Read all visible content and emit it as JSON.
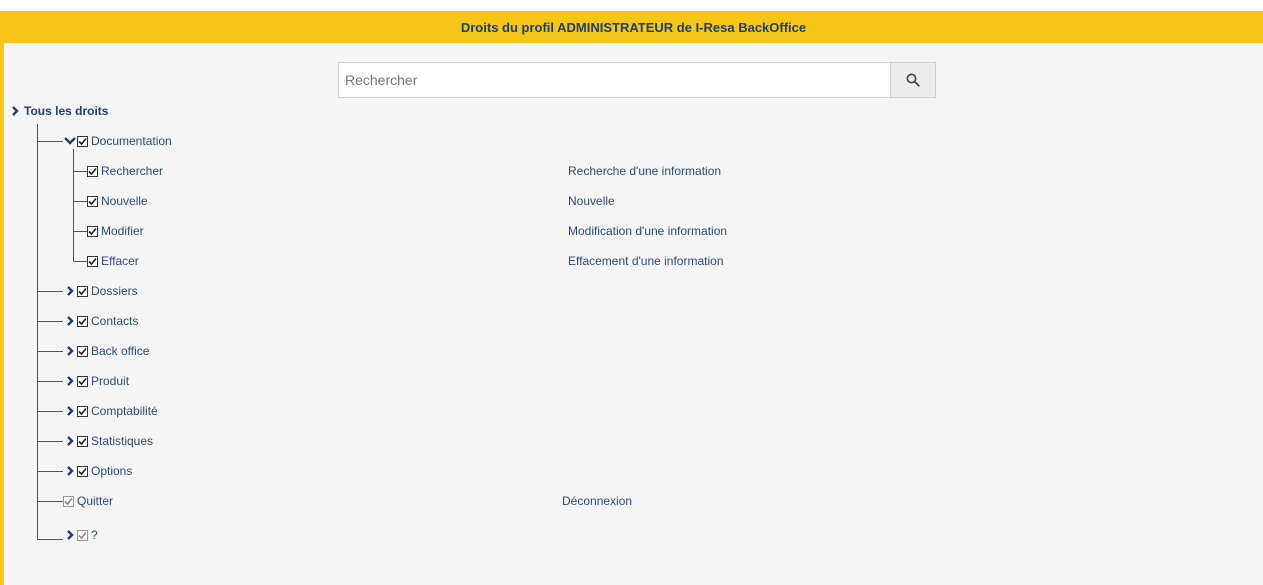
{
  "header": {
    "title": "Droits du profil ADMINISTRATEUR de I-Resa BackOffice"
  },
  "search": {
    "placeholder": "Rechercher"
  },
  "tree": {
    "root_label": "Tous les droits",
    "documentation": {
      "label": "Documentation",
      "children": [
        {
          "label": "Rechercher",
          "description": "Recherche d'une information"
        },
        {
          "label": "Nouvelle",
          "description": "Nouvelle"
        },
        {
          "label": "Modifier",
          "description": "Modification d'une information"
        },
        {
          "label": "Effacer",
          "description": "Effacement d'une information"
        }
      ]
    },
    "groups": [
      {
        "label": "Dossiers"
      },
      {
        "label": "Contacts"
      },
      {
        "label": "Back office"
      },
      {
        "label": "Produit"
      },
      {
        "label": "Comptabilité"
      },
      {
        "label": "Statistiques"
      },
      {
        "label": "Options"
      }
    ],
    "quitter": {
      "label": "Quitter",
      "description": "Déconnexion"
    },
    "help": {
      "label": "?"
    }
  },
  "colors": {
    "accent": "#f5c518",
    "text": "#2a4a7b",
    "background": "#f5f5f5"
  }
}
